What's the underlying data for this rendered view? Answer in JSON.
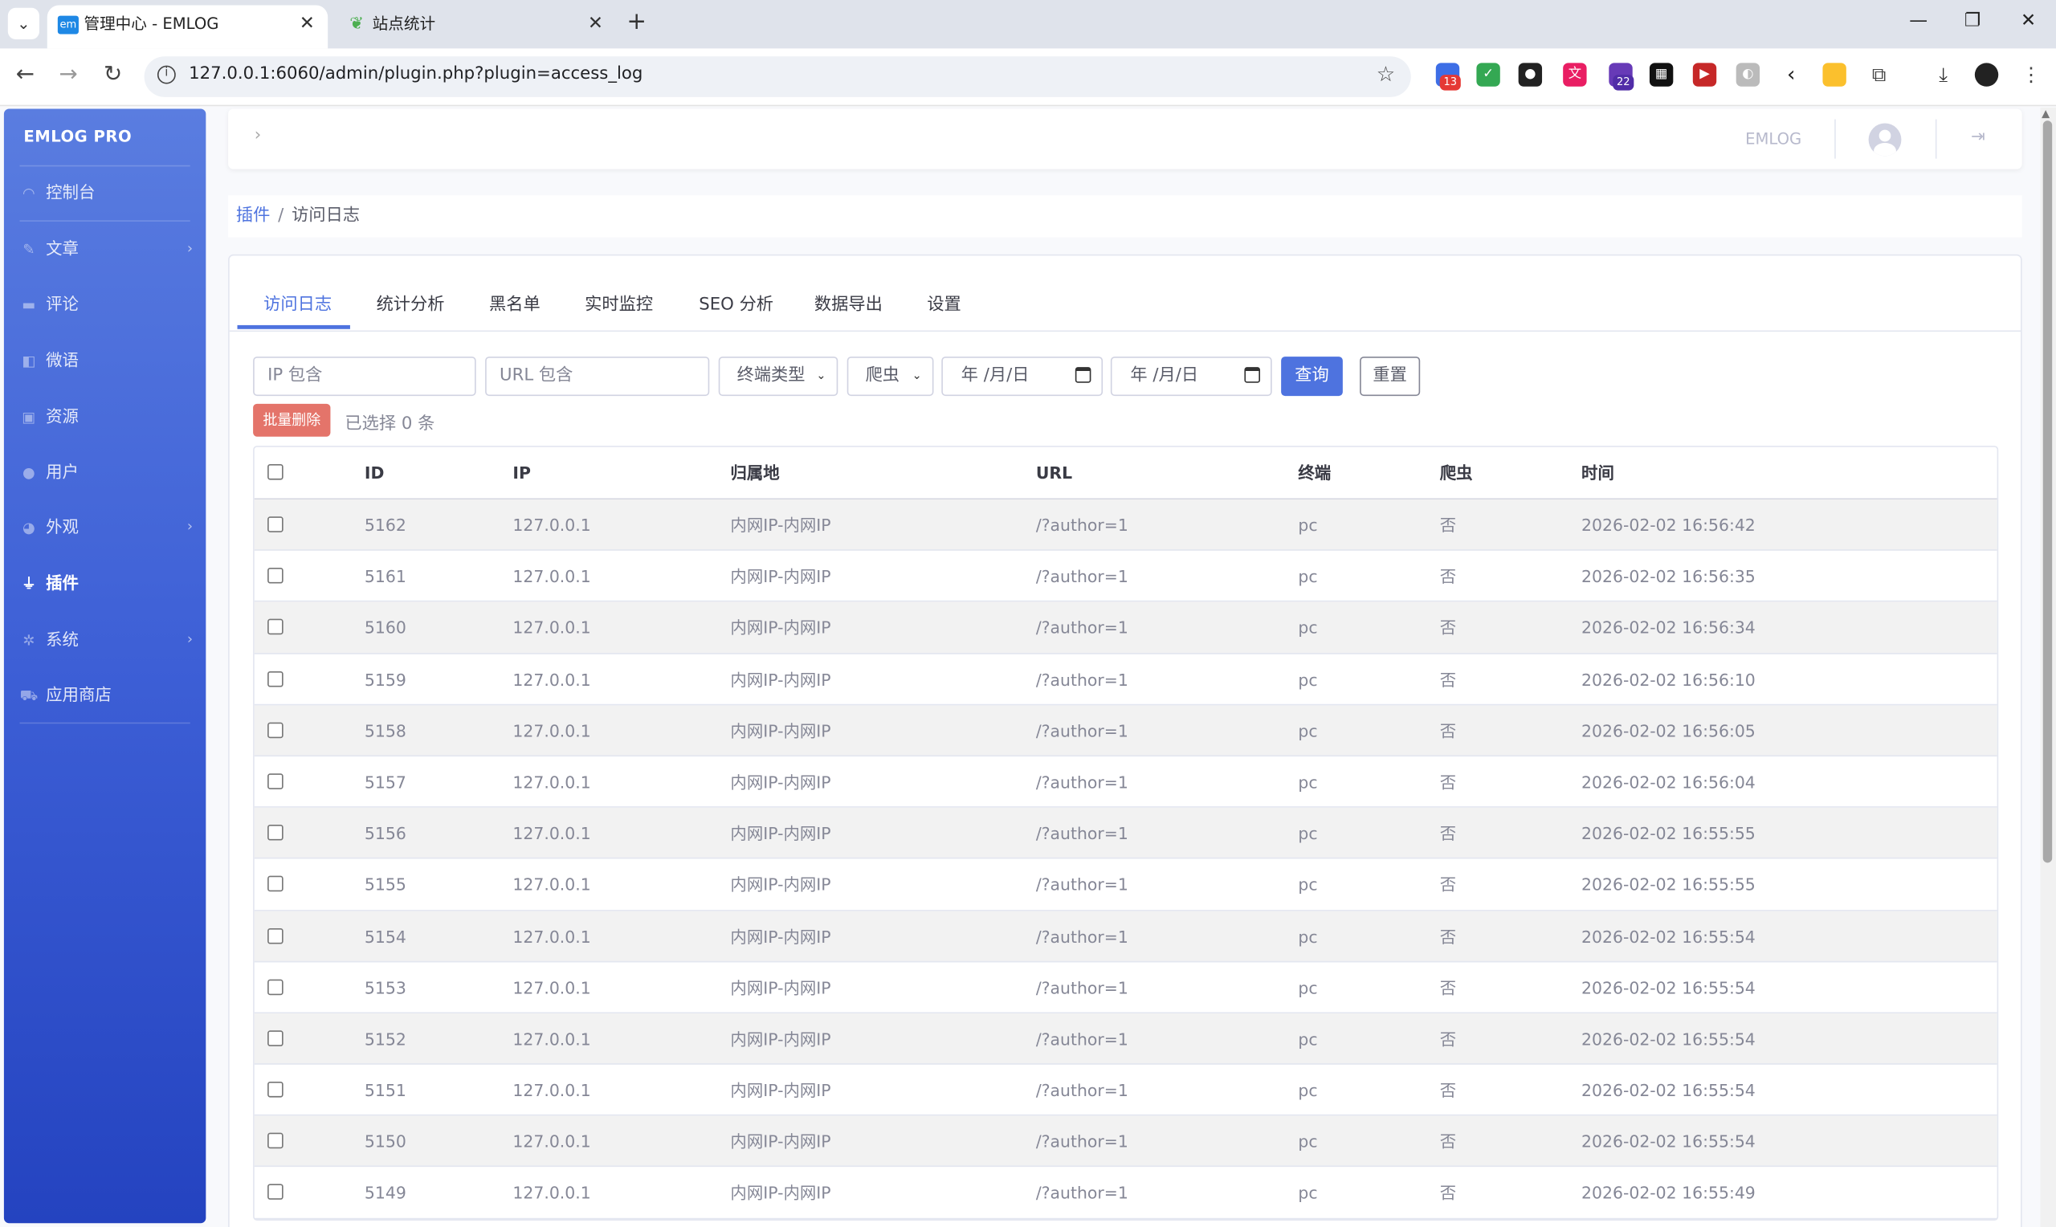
{
  "browser": {
    "tabs": [
      {
        "title": "管理中心 - EMLOG",
        "favicon": "em",
        "active": true
      },
      {
        "title": "站点统计",
        "favicon": "cactus",
        "active": false
      }
    ],
    "url": "127.0.0.1:6060/admin/plugin.php?plugin=access_log",
    "extension_badges": [
      "13",
      "22"
    ]
  },
  "sidebar": {
    "brand": "EMLOG PRO",
    "items": [
      {
        "label": "控制台",
        "icon": "dashboard-icon",
        "chevron": false,
        "active": false
      },
      {
        "label": "文章",
        "icon": "pen-icon",
        "chevron": true,
        "active": false
      },
      {
        "label": "评论",
        "icon": "comment-icon",
        "chevron": false,
        "active": false
      },
      {
        "label": "微语",
        "icon": "book-icon",
        "chevron": false,
        "active": false
      },
      {
        "label": "资源",
        "icon": "image-icon",
        "chevron": false,
        "active": false
      },
      {
        "label": "用户",
        "icon": "user-icon",
        "chevron": false,
        "active": false
      },
      {
        "label": "外观",
        "icon": "palette-icon",
        "chevron": true,
        "active": false
      },
      {
        "label": "插件",
        "icon": "plug-icon",
        "chevron": false,
        "active": true
      },
      {
        "label": "系统",
        "icon": "gear-icon",
        "chevron": true,
        "active": false
      },
      {
        "label": "应用商店",
        "icon": "cart-icon",
        "chevron": false,
        "active": false
      }
    ]
  },
  "topbar": {
    "site_name": "EMLOG"
  },
  "breadcrumb": {
    "parent": "插件",
    "current": "访问日志"
  },
  "tabs": [
    "访问日志",
    "统计分析",
    "黑名单",
    "实时监控",
    "SEO 分析",
    "数据导出",
    "设置"
  ],
  "filters": {
    "ip_placeholder": "IP 包含",
    "url_placeholder": "URL 包含",
    "device_select": "终端类型",
    "bot_select": "爬虫",
    "date_from": "年 /月/日",
    "date_to": "年 /月/日",
    "query_button": "查询",
    "reset_button": "重置"
  },
  "bulk": {
    "delete_button": "批量删除",
    "selected_text": "已选择 0 条"
  },
  "table": {
    "columns": [
      "ID",
      "IP",
      "归属地",
      "URL",
      "终端",
      "爬虫",
      "时间"
    ],
    "rows": [
      [
        "5162",
        "127.0.0.1",
        "内网IP-内网IP",
        "/?author=1",
        "pc",
        "否",
        "2026-02-02 16:56:42"
      ],
      [
        "5161",
        "127.0.0.1",
        "内网IP-内网IP",
        "/?author=1",
        "pc",
        "否",
        "2026-02-02 16:56:35"
      ],
      [
        "5160",
        "127.0.0.1",
        "内网IP-内网IP",
        "/?author=1",
        "pc",
        "否",
        "2026-02-02 16:56:34"
      ],
      [
        "5159",
        "127.0.0.1",
        "内网IP-内网IP",
        "/?author=1",
        "pc",
        "否",
        "2026-02-02 16:56:10"
      ],
      [
        "5158",
        "127.0.0.1",
        "内网IP-内网IP",
        "/?author=1",
        "pc",
        "否",
        "2026-02-02 16:56:05"
      ],
      [
        "5157",
        "127.0.0.1",
        "内网IP-内网IP",
        "/?author=1",
        "pc",
        "否",
        "2026-02-02 16:56:04"
      ],
      [
        "5156",
        "127.0.0.1",
        "内网IP-内网IP",
        "/?author=1",
        "pc",
        "否",
        "2026-02-02 16:55:55"
      ],
      [
        "5155",
        "127.0.0.1",
        "内网IP-内网IP",
        "/?author=1",
        "pc",
        "否",
        "2026-02-02 16:55:55"
      ],
      [
        "5154",
        "127.0.0.1",
        "内网IP-内网IP",
        "/?author=1",
        "pc",
        "否",
        "2026-02-02 16:55:54"
      ],
      [
        "5153",
        "127.0.0.1",
        "内网IP-内网IP",
        "/?author=1",
        "pc",
        "否",
        "2026-02-02 16:55:54"
      ],
      [
        "5152",
        "127.0.0.1",
        "内网IP-内网IP",
        "/?author=1",
        "pc",
        "否",
        "2026-02-02 16:55:54"
      ],
      [
        "5151",
        "127.0.0.1",
        "内网IP-内网IP",
        "/?author=1",
        "pc",
        "否",
        "2026-02-02 16:55:54"
      ],
      [
        "5150",
        "127.0.0.1",
        "内网IP-内网IP",
        "/?author=1",
        "pc",
        "否",
        "2026-02-02 16:55:54"
      ],
      [
        "5149",
        "127.0.0.1",
        "内网IP-内网IP",
        "/?author=1",
        "pc",
        "否",
        "2026-02-02 16:55:49"
      ]
    ]
  },
  "colors": {
    "primary": "#4e73df",
    "danger": "#e4746a",
    "sidebar_top": "#5a7de0",
    "sidebar_bottom": "#2443c0"
  }
}
